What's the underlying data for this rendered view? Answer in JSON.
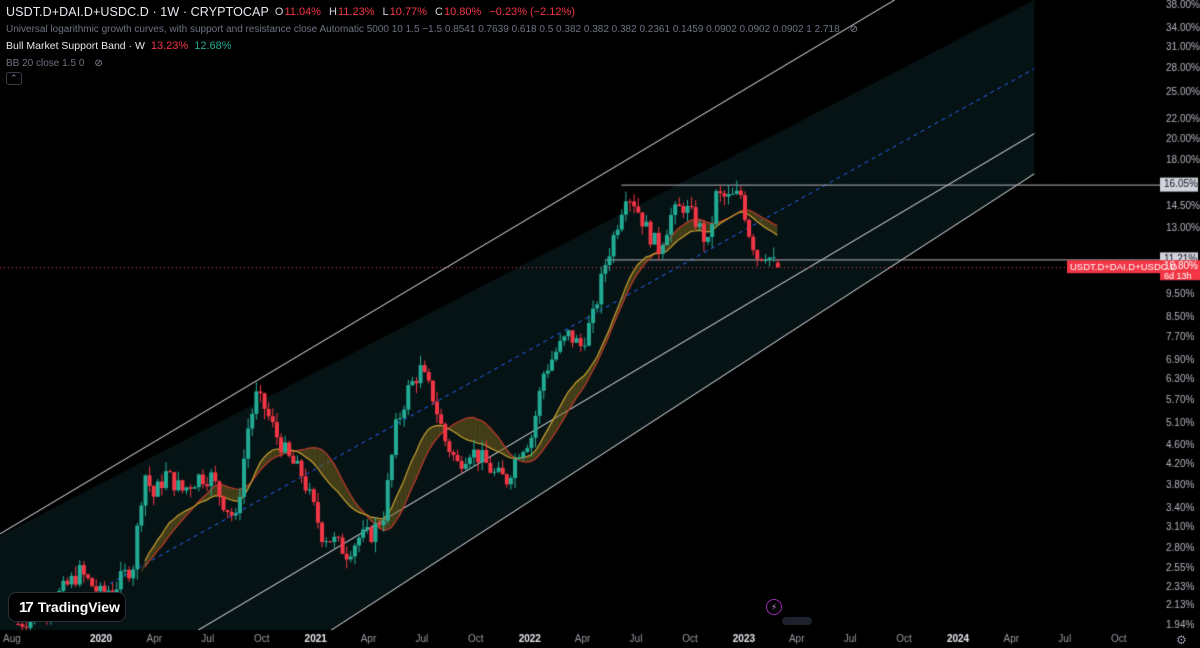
{
  "header": {
    "symbol": "USDT.D+DAI.D+USDC.D · 1W · CRYPTOCAP",
    "ohlc": {
      "o_label": "O",
      "o": "11.04%",
      "h_label": "H",
      "h": "11.23%",
      "l_label": "L",
      "l": "10.77%",
      "c_label": "C",
      "c": "10.80%",
      "change": "−0.23% (−2.12%)"
    },
    "indicator1": "Universal logarithmic growth curves, with support and resistance close Automatic 5000 10 1.5 −1.5 0.8541 0.7639 0.618 0.5 0.382 0.382 0.382 0.2361 0.1459 0.0902 0.0902 0.0902 1 2.718",
    "indicator2_name": "Bull Market Support Band · W",
    "indicator2_v1": "13.23%",
    "indicator2_v2": "12.68%",
    "indicator3": "BB 20 close 1.5 0"
  },
  "brand": {
    "logo_text": "TradingView",
    "logo_mark": "17"
  },
  "icons": {
    "bolt": "⚡",
    "settings": "⚙",
    "eye": "⊘"
  },
  "colors": {
    "up": "#22ab94",
    "down": "#f23645",
    "channel": "#e6e8ee",
    "mid": "#2962ff",
    "band": "#c8a030",
    "band_fill": "#6a5a1a",
    "bg": "#000000"
  },
  "chart_data": {
    "type": "candlestick",
    "y_scale": "log",
    "yticks": [
      "38.00%",
      "34.00%",
      "31.00%",
      "28.00%",
      "25.00%",
      "22.00%",
      "20.00%",
      "18.00%",
      "16.05%",
      "14.50%",
      "13.00%",
      "11.21%",
      "10.80%",
      "9.50%",
      "8.50%",
      "7.70%",
      "6.90%",
      "6.30%",
      "5.70%",
      "5.10%",
      "4.60%",
      "4.20%",
      "3.80%",
      "3.40%",
      "3.10%",
      "2.80%",
      "2.55%",
      "2.33%",
      "2.13%",
      "1.94%"
    ],
    "ytick_values": [
      38,
      34,
      31,
      28,
      25,
      22,
      20,
      18,
      16.05,
      14.5,
      13,
      11.21,
      10.8,
      9.5,
      8.5,
      7.7,
      6.9,
      6.3,
      5.7,
      5.1,
      4.6,
      4.2,
      3.8,
      3.4,
      3.1,
      2.8,
      2.55,
      2.33,
      2.13,
      1.94
    ],
    "ylim": [
      1.92,
      39.5
    ],
    "xticks": [
      "Aug",
      "2020",
      "Apr",
      "Jul",
      "Oct",
      "2021",
      "Apr",
      "Jul",
      "Oct",
      "2022",
      "Apr",
      "Jul",
      "Oct",
      "2023",
      "Apr",
      "Jul",
      "Oct",
      "2024",
      "Apr",
      "Jul",
      "Oct"
    ],
    "xtick_dates": [
      "2019-08-01",
      "2020-01-01",
      "2020-04-01",
      "2020-07-01",
      "2020-10-01",
      "2021-01-01",
      "2021-04-01",
      "2021-07-01",
      "2021-10-01",
      "2022-01-01",
      "2022-04-01",
      "2022-07-01",
      "2022-10-01",
      "2023-01-01",
      "2023-04-01",
      "2023-07-01",
      "2023-10-01",
      "2024-01-01",
      "2024-04-01",
      "2024-07-01",
      "2024-10-01"
    ],
    "price_label": {
      "name": "USDT.D+DAI.D+USDC.D",
      "value": "10.80%",
      "countdown": "6d 13h"
    },
    "levels": [
      {
        "label": "16.05%",
        "value": 16.05,
        "from": "2022-06-06"
      },
      {
        "label": "11.21%",
        "value": 11.21,
        "from": "2022-05-09"
      }
    ],
    "channel": {
      "upper": [
        [
          "2019-06-01",
          2.8
        ],
        [
          "2023-10-01",
          40.0
        ]
      ],
      "mid": [
        [
          "2019-10-01",
          2.0
        ],
        [
          "2024-05-10",
          28.0
        ]
      ],
      "lower1": [
        [
          "2020-06-01",
          1.85
        ],
        [
          "2024-05-10",
          20.5
        ]
      ],
      "lower2": [
        [
          "2021-01-15",
          1.85
        ],
        [
          "2024-05-10",
          16.9
        ]
      ]
    },
    "fill_until": "2024-05-10",
    "closes": [
      [
        "2019-08-12",
        1.95
      ],
      [
        "2019-09-16",
        2.05
      ],
      [
        "2019-10-21",
        2.25
      ],
      [
        "2019-11-25",
        2.5
      ],
      [
        "2019-12-30",
        2.25
      ],
      [
        "2020-01-27",
        2.35
      ],
      [
        "2020-02-24",
        2.6
      ],
      [
        "2020-03-09",
        3.6
      ],
      [
        "2020-03-16",
        4.0
      ],
      [
        "2020-03-30",
        3.6
      ],
      [
        "2020-04-20",
        4.0
      ],
      [
        "2020-05-18",
        3.7
      ],
      [
        "2020-06-15",
        3.95
      ],
      [
        "2020-07-06",
        3.95
      ],
      [
        "2020-07-27",
        3.5
      ],
      [
        "2020-08-17",
        3.2
      ],
      [
        "2020-09-07",
        5.0
      ],
      [
        "2020-09-21",
        5.8
      ],
      [
        "2020-10-05",
        5.5
      ],
      [
        "2020-10-26",
        4.8
      ],
      [
        "2020-11-16",
        4.3
      ],
      [
        "2020-12-07",
        4.0
      ],
      [
        "2020-12-28",
        3.4
      ],
      [
        "2021-01-11",
        3.0
      ],
      [
        "2021-02-01",
        2.9
      ],
      [
        "2021-02-22",
        2.75
      ],
      [
        "2021-03-15",
        2.95
      ],
      [
        "2021-04-05",
        3.0
      ],
      [
        "2021-04-26",
        3.3
      ],
      [
        "2021-05-17",
        5.0
      ],
      [
        "2021-06-07",
        6.0
      ],
      [
        "2021-06-28",
        6.6
      ],
      [
        "2021-07-19",
        5.8
      ],
      [
        "2021-08-09",
        4.7
      ],
      [
        "2021-08-30",
        4.2
      ],
      [
        "2021-09-20",
        4.5
      ],
      [
        "2021-10-11",
        4.3
      ],
      [
        "2021-11-01",
        4.0
      ],
      [
        "2021-11-22",
        3.9
      ],
      [
        "2021-12-13",
        4.5
      ],
      [
        "2022-01-03",
        4.8
      ],
      [
        "2022-01-24",
        6.5
      ],
      [
        "2022-02-14",
        7.2
      ],
      [
        "2022-03-07",
        7.8
      ],
      [
        "2022-03-28",
        7.4
      ],
      [
        "2022-04-18",
        8.5
      ],
      [
        "2022-05-09",
        11.0
      ],
      [
        "2022-05-23",
        12.5
      ],
      [
        "2022-06-13",
        15.5
      ],
      [
        "2022-06-27",
        14.8
      ],
      [
        "2022-07-18",
        13.0
      ],
      [
        "2022-08-08",
        11.8
      ],
      [
        "2022-08-29",
        13.8
      ],
      [
        "2022-09-19",
        14.5
      ],
      [
        "2022-10-10",
        13.5
      ],
      [
        "2022-10-31",
        12.0
      ],
      [
        "2022-11-14",
        15.2
      ],
      [
        "2022-12-05",
        15.0
      ],
      [
        "2022-12-26",
        15.3
      ],
      [
        "2023-01-09",
        12.8
      ],
      [
        "2023-01-23",
        11.4
      ],
      [
        "2023-02-06",
        11.6
      ],
      [
        "2023-02-20",
        11.0
      ],
      [
        "2023-02-27",
        10.8
      ]
    ],
    "band_upper_start": "2020-03-16",
    "band_start_value": 2.3
  }
}
